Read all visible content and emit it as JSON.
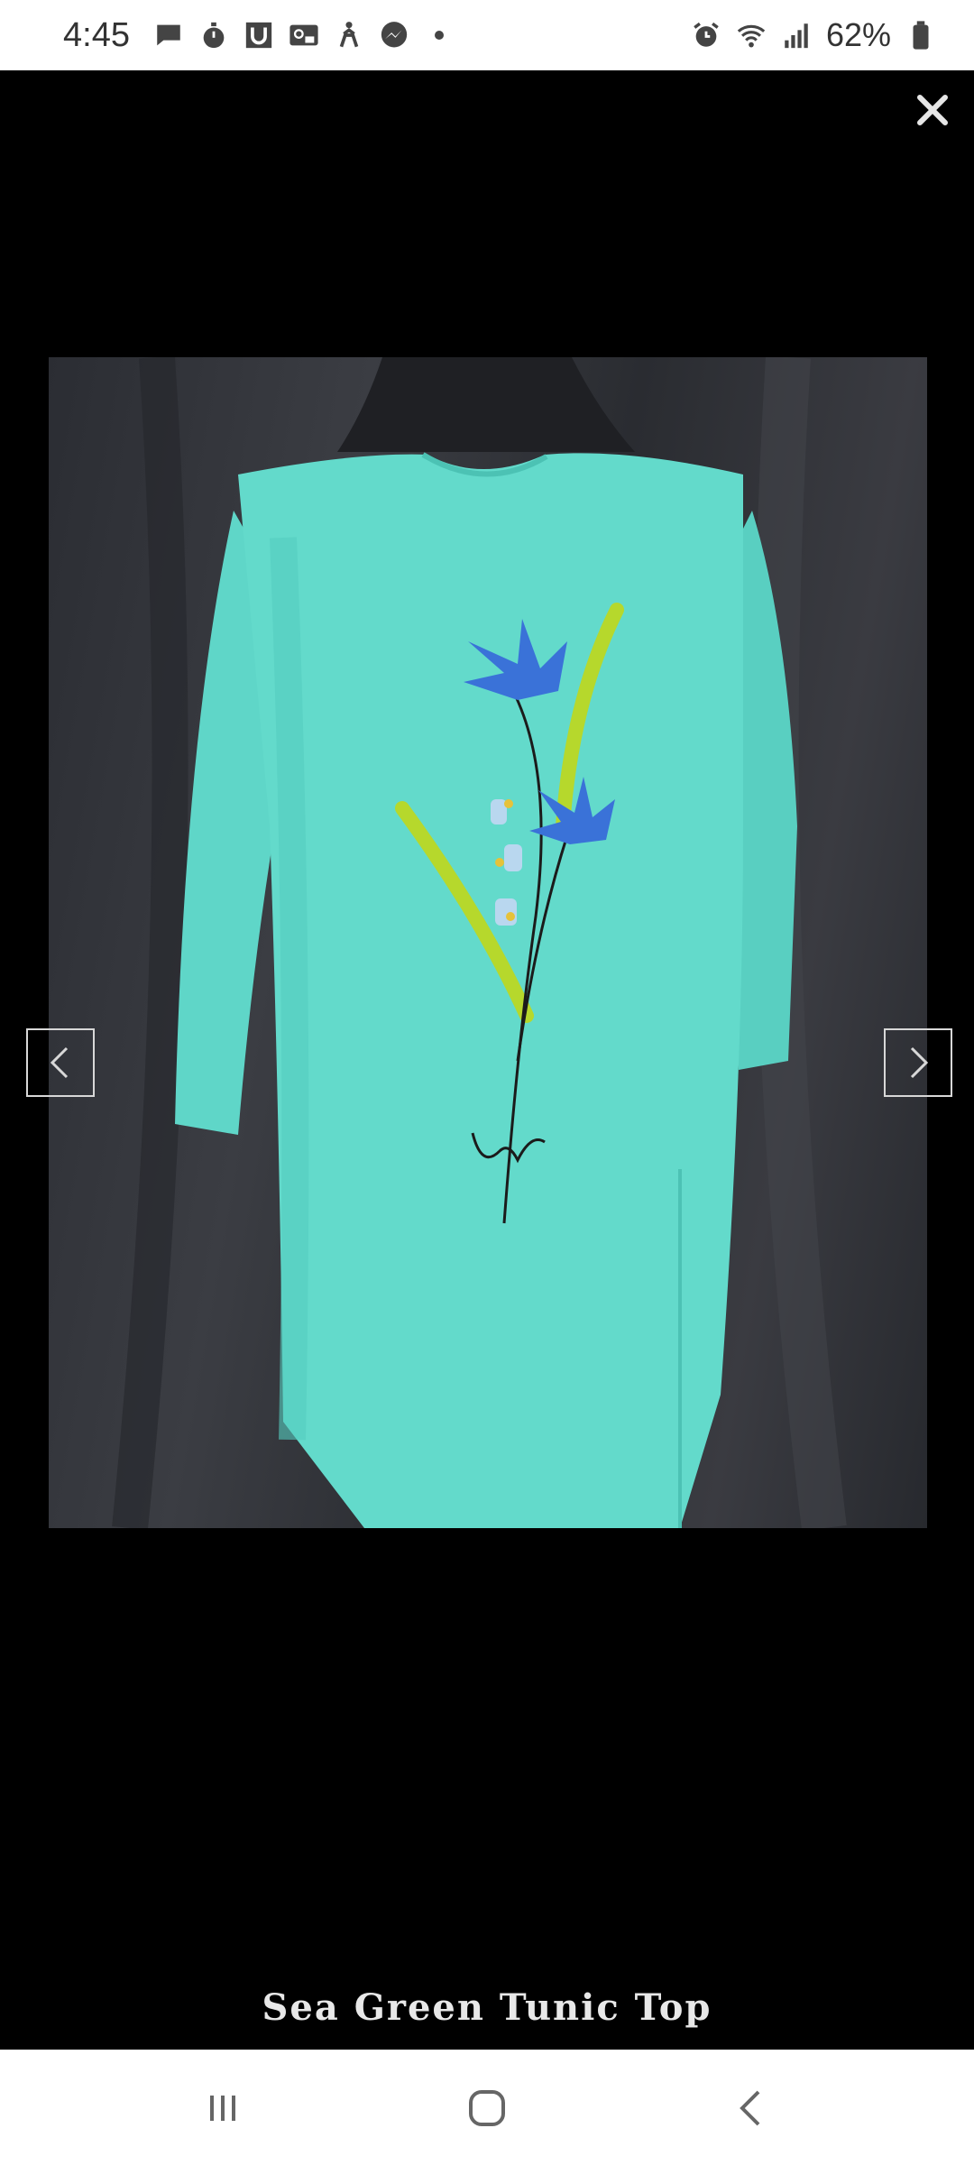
{
  "status_bar": {
    "time": "4:45",
    "battery_percent": "62%",
    "left_icons": [
      "message-icon",
      "stopwatch-icon",
      "u-app-icon",
      "voicemail-icon",
      "accessibility-icon",
      "messenger-icon"
    ],
    "right_icons": [
      "alarm-icon",
      "wifi-icon",
      "signal-icon",
      "battery-icon"
    ]
  },
  "viewer": {
    "caption": "Sea Green Tunic Top",
    "close_icon": "close-icon",
    "prev_icon": "chevron-left-icon",
    "next_icon": "chevron-right-icon",
    "image": {
      "subject": "sea green tunic top on dress form",
      "background_color": "#34363c",
      "garment_color": "#5fd6c8"
    }
  },
  "nav_bar": {
    "buttons": [
      "recents-icon",
      "home-icon",
      "back-icon"
    ]
  }
}
